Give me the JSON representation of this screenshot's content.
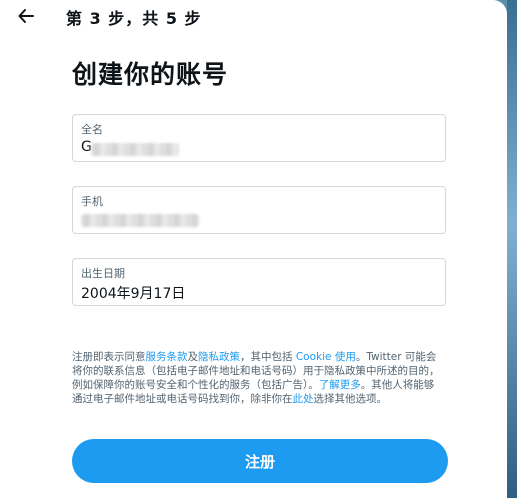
{
  "header": {
    "step_label": "第 3 步，共 5 步",
    "back_icon": "arrow-left-icon"
  },
  "page": {
    "title": "创建你的账号"
  },
  "form": {
    "name": {
      "label": "全名",
      "value_visible_prefix": "G"
    },
    "phone": {
      "label": "手机"
    },
    "birthdate": {
      "label": "出生日期",
      "value": "2004年9月17日"
    }
  },
  "legal": {
    "part1": "注册即表示同意",
    "terms_link": "服务条款",
    "part2": "及",
    "privacy_link": "隐私政策",
    "part3": "，其中包括 ",
    "cookie_link": "Cookie 使用",
    "part4": "。Twitter 可能会将你的联系信息（包括电子邮件地址和电话号码）用于隐私政策中所述的目的，例如保障你的账号安全和个性化的服务（包括广告）。",
    "learn_more_link": "了解更多",
    "part5": "。其他人将能够通过电子邮件地址或电话号码找到你，除非你在",
    "here_link": "此处",
    "part6": "选择其他选项。"
  },
  "actions": {
    "signup_label": "注册"
  },
  "colors": {
    "accent": "#1d9bf0",
    "text_primary": "#0f1419",
    "text_secondary": "#536471",
    "border": "#cfd9de"
  }
}
